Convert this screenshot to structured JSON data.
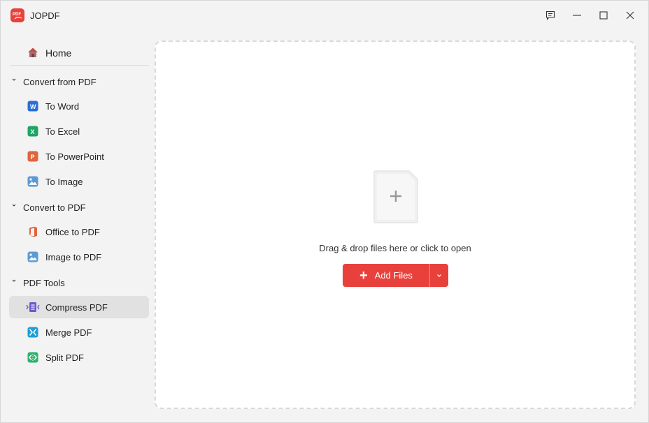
{
  "app": {
    "title": "JOPDF",
    "logo_text": "PDF"
  },
  "sidebar": {
    "home": "Home",
    "sections": [
      {
        "label": "Convert from PDF",
        "items": [
          "To Word",
          "To Excel",
          "To PowerPoint",
          "To Image"
        ]
      },
      {
        "label": "Convert to PDF",
        "items": [
          "Office to PDF",
          "Image to PDF"
        ]
      },
      {
        "label": "PDF Tools",
        "items": [
          "Compress PDF",
          "Merge PDF",
          "Split PDF"
        ]
      }
    ],
    "active_item": "Compress PDF"
  },
  "main": {
    "drop_text": "Drag & drop files here or click to open",
    "add_files_label": "Add Files",
    "add_files_plus": "+"
  },
  "icons": {
    "word_letter": "W",
    "excel_letter": "X",
    "powerpoint_letter": "P"
  },
  "colors": {
    "accent": "#e8413c",
    "word": "#2b6fd6",
    "excel": "#21a366",
    "powerpoint": "#e0643c"
  }
}
